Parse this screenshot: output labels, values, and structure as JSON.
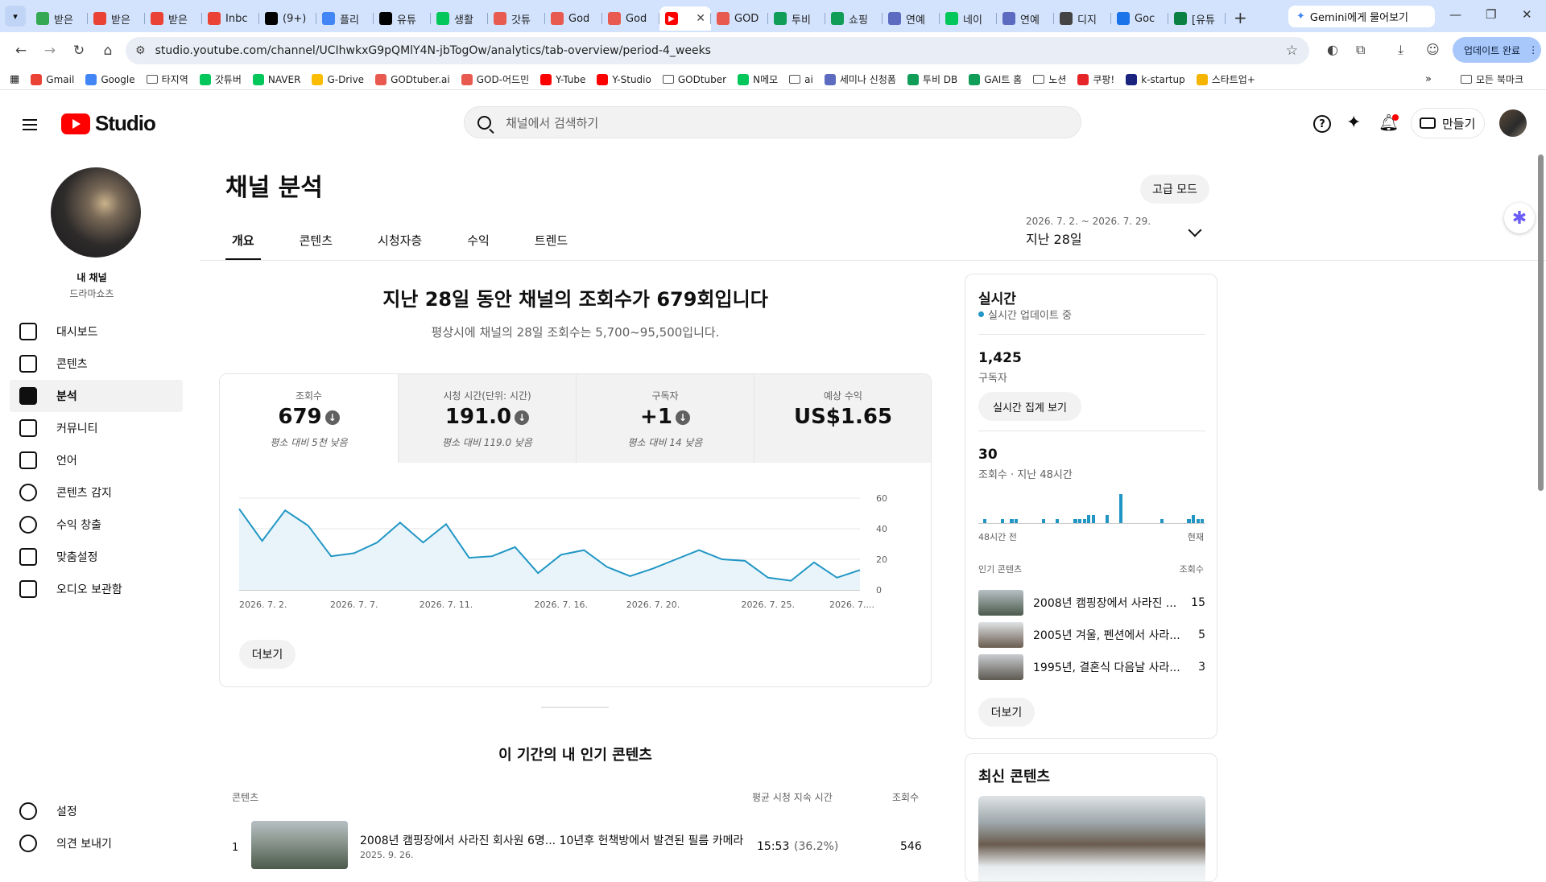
{
  "browser": {
    "tabs": [
      {
        "label": "받은",
        "icon": "gmail-shield-icon",
        "color": "#34a853"
      },
      {
        "label": "받은",
        "icon": "gmail-icon",
        "color": "#ea4335"
      },
      {
        "label": "받은",
        "icon": "gmail-icon",
        "color": "#ea4335"
      },
      {
        "label": "Inbc",
        "icon": "gmail-icon",
        "color": "#ea4335"
      },
      {
        "label": "(9+)",
        "icon": "notion-icon",
        "color": "#000000"
      },
      {
        "label": "플리",
        "icon": "google-icon",
        "color": "#4285f4"
      },
      {
        "label": "유튜",
        "icon": "pb-icon",
        "color": "#000000"
      },
      {
        "label": "생활",
        "icon": "naver-icon",
        "color": "#03c75a"
      },
      {
        "label": "갓튜",
        "icon": "god-icon",
        "color": "#e85a4f"
      },
      {
        "label": "God",
        "icon": "god-icon",
        "color": "#e85a4f"
      },
      {
        "label": "God",
        "icon": "god-icon",
        "color": "#e85a4f"
      },
      {
        "label": "",
        "icon": "youtube-studio-icon",
        "color": "#ff0000",
        "active": true
      },
      {
        "label": "GOD",
        "icon": "god-icon",
        "color": "#e85a4f"
      },
      {
        "label": "투비",
        "icon": "tubi-icon",
        "color": "#0f9d58"
      },
      {
        "label": "쇼핑",
        "icon": "tubi-icon",
        "color": "#0f9d58"
      },
      {
        "label": "연예",
        "icon": "tv-icon",
        "color": "#5c6bc0"
      },
      {
        "label": "네이",
        "icon": "check-icon",
        "color": "#03c75a"
      },
      {
        "label": "연예",
        "icon": "tv-icon",
        "color": "#5c6bc0"
      },
      {
        "label": "디지",
        "icon": "chatgpt-icon",
        "color": "#444444"
      },
      {
        "label": "Goc",
        "icon": "calendar-icon",
        "color": "#1a73e8"
      },
      {
        "label": "[유튜",
        "icon": "sheet-icon",
        "color": "#0b8043"
      }
    ],
    "gemini_label": "Gemini에게 물어보기",
    "url": "studio.youtube.com/channel/UCIhwkxG9pQMlY4N-jbTogOw/analytics/tab-overview/period-4_weeks",
    "update_label": "업데이트 완료",
    "bookmarks": [
      {
        "label": "Gmail",
        "icon": "gmail-icon",
        "color": "#ea4335"
      },
      {
        "label": "Google",
        "icon": "google-icon",
        "color": "#4285f4"
      },
      {
        "label": "타지역",
        "icon": "folder-icon",
        "color": ""
      },
      {
        "label": "갓튜버",
        "icon": "naver-icon",
        "color": "#03c75a"
      },
      {
        "label": "NAVER",
        "icon": "naver-icon",
        "color": "#03c75a"
      },
      {
        "label": "G-Drive",
        "icon": "drive-icon",
        "color": "#fbbc04"
      },
      {
        "label": "GODtuber.ai",
        "icon": "god-icon",
        "color": "#e85a4f"
      },
      {
        "label": "GOD-어드민",
        "icon": "god-icon",
        "color": "#e85a4f"
      },
      {
        "label": "Y-Tube",
        "icon": "youtube-icon",
        "color": "#ff0000"
      },
      {
        "label": "Y-Studio",
        "icon": "youtube-icon",
        "color": "#ff0000"
      },
      {
        "label": "GODtuber",
        "icon": "folder-icon",
        "color": ""
      },
      {
        "label": "N메모",
        "icon": "naver-icon",
        "color": "#03c75a"
      },
      {
        "label": "ai",
        "icon": "folder-icon",
        "color": ""
      },
      {
        "label": "세미나 신청폼",
        "icon": "form-icon",
        "color": "#5c6bc0"
      },
      {
        "label": "투비 DB",
        "icon": "tubi-icon",
        "color": "#0f9d58"
      },
      {
        "label": "GAI트 홈",
        "icon": "tubi-icon",
        "color": "#0f9d58"
      },
      {
        "label": "노션",
        "icon": "folder-icon",
        "color": ""
      },
      {
        "label": "쿠팡!",
        "icon": "coupang-icon",
        "color": "#e52528"
      },
      {
        "label": "k-startup",
        "icon": "ks-icon",
        "color": "#1a237e"
      },
      {
        "label": "스타트업+",
        "icon": "star-icon",
        "color": "#f4b400"
      }
    ],
    "all_bookmarks": "모든 북마크"
  },
  "studio": {
    "logo_text": "Studio",
    "search_placeholder": "채널에서 검색하기",
    "create_label": "만들기"
  },
  "sidebar": {
    "channel_name": "내 채널",
    "channel_sub": "드라마쇼츠",
    "items": [
      {
        "label": "대시보드",
        "icon": "dashboard-icon"
      },
      {
        "label": "콘텐츠",
        "icon": "content-icon"
      },
      {
        "label": "분석",
        "icon": "analytics-icon",
        "selected": true
      },
      {
        "label": "커뮤니티",
        "icon": "community-icon"
      },
      {
        "label": "언어",
        "icon": "subtitles-icon"
      },
      {
        "label": "콘텐츠 감지",
        "icon": "copyright-icon"
      },
      {
        "label": "수익 창출",
        "icon": "monetization-icon"
      },
      {
        "label": "맞춤설정",
        "icon": "customization-icon"
      },
      {
        "label": "오디오 보관함",
        "icon": "audio-library-icon"
      }
    ],
    "bottom": [
      {
        "label": "설정",
        "icon": "settings-icon"
      },
      {
        "label": "의견 보내기",
        "icon": "feedback-icon"
      }
    ]
  },
  "page": {
    "title": "채널 분석",
    "advanced_mode": "고급 모드",
    "tabs": [
      "개요",
      "콘텐츠",
      "시청자층",
      "수익",
      "트렌드"
    ],
    "date_range": "2026. 7. 2. ~ 2026. 7. 29.",
    "date_label": "지난 28일",
    "headline": "지난 28일 동안 채널의 조회수가 679회입니다",
    "subline": "평상시에 채널의 28일 조회수는 5,700~95,500입니다."
  },
  "metrics": [
    {
      "label": "조회수",
      "value": "679",
      "note": "평소 대비 5천 낮음",
      "down": true
    },
    {
      "label": "시청 시간(단위: 시간)",
      "value": "191.0",
      "note": "평소 대비 119.0 낮음",
      "down": true
    },
    {
      "label": "구독자",
      "value": "+1",
      "note": "평소 대비 14 낮음",
      "down": true
    },
    {
      "label": "예상 수익",
      "value": "US$1.65",
      "note": "",
      "down": false
    }
  ],
  "chart_data": {
    "type": "area",
    "x": [
      "2026. 7. 2.",
      "2026. 7. 3.",
      "2026. 7. 4.",
      "2026. 7. 5.",
      "2026. 7. 6.",
      "2026. 7. 7.",
      "2026. 7. 8.",
      "2026. 7. 9.",
      "2026. 7. 10.",
      "2026. 7. 11.",
      "2026. 7. 12.",
      "2026. 7. 13.",
      "2026. 7. 14.",
      "2026. 7. 15.",
      "2026. 7. 16.",
      "2026. 7. 17.",
      "2026. 7. 18.",
      "2026. 7. 19.",
      "2026. 7. 20.",
      "2026. 7. 21.",
      "2026. 7. 22.",
      "2026. 7. 23.",
      "2026. 7. 24.",
      "2026. 7. 25.",
      "2026. 7. 26.",
      "2026. 7. 27.",
      "2026. 7. 28.",
      "2026. 7. 29."
    ],
    "values": [
      53,
      32,
      52,
      42,
      22,
      24,
      31,
      44,
      31,
      43,
      21,
      22,
      28,
      11,
      23,
      26,
      15,
      9,
      14,
      20,
      26,
      20,
      19,
      8,
      6,
      18,
      8,
      13
    ],
    "x_tick_labels": [
      "2026. 7. 2.",
      "2026. 7. 7.",
      "2026. 7. 11.",
      "2026. 7. 16.",
      "2026. 7. 20.",
      "2026. 7. 25.",
      "2026. 7...."
    ],
    "y_ticks": [
      0,
      20,
      40,
      60
    ],
    "ylim": [
      0,
      60
    ],
    "color": "#2196c4",
    "fill": "#e8f4fa"
  },
  "more_label": "더보기",
  "top_content": {
    "title": "이 기간의 내 인기 콘텐츠",
    "col_content": "콘텐츠",
    "col_avg": "평균 시청 지속 시간",
    "col_views": "조회수",
    "rows": [
      {
        "rank": "1",
        "title": "2008년 캠핑장에서 사라진 회사원 6명... 10년후 헌책방에서 발견된 필름 카메라 ...",
        "date": "2025. 9. 26.",
        "avg": "15:53",
        "pct": "(36.2%)",
        "views": "546"
      }
    ]
  },
  "realtime": {
    "title": "실시간",
    "status": "실시간 업데이트 중",
    "subs_value": "1,425",
    "subs_label": "구독자",
    "view_btn": "실시간 집계 보기",
    "views_value": "30",
    "views_label": "조회수 · 지난 48시간",
    "bars": [
      0,
      1,
      0,
      0,
      0,
      1,
      0,
      1,
      1,
      0,
      0,
      0,
      0,
      0,
      1,
      0,
      0,
      1,
      0,
      0,
      0,
      1,
      1,
      1,
      2,
      2,
      0,
      0,
      2,
      0,
      0,
      7,
      0,
      0,
      0,
      0,
      0,
      0,
      0,
      0,
      1,
      0,
      0,
      0,
      0,
      0,
      1,
      2,
      1,
      1
    ],
    "axis_left": "48시간 전",
    "axis_right": "현재",
    "popular_label": "인기 콘텐츠",
    "views_col": "조회수",
    "popular": [
      {
        "title": "2008년 캠핑장에서 사라진 ...",
        "views": "15"
      },
      {
        "title": "2005년 겨울, 펜션에서 사라...",
        "views": "5"
      },
      {
        "title": "1995년, 결혼식 다음날 사라...",
        "views": "3"
      }
    ]
  },
  "latest": {
    "title": "최신 콘텐츠"
  }
}
